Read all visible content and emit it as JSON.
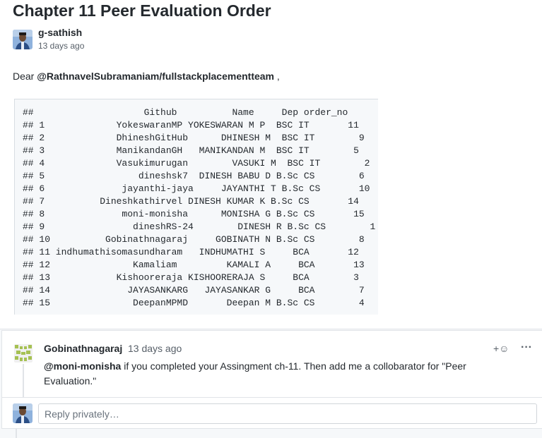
{
  "issue": {
    "title": "Chapter 11 Peer Evaluation Order",
    "author": "g-sathish",
    "time": "13 days ago"
  },
  "body": {
    "greeting_prefix": "Dear ",
    "mention": "@RathnavelSubramaniam/fullstackplacementteam",
    "greeting_suffix": " ,",
    "code_lines": [
      "##                    Github          Name     Dep order_no",
      "## 1             YokeswaranMP YOKESWARAN M P  BSC IT       11",
      "## 2             DhineshGitHub      DHINESH M  BSC IT        9",
      "## 3             ManikandanGH   MANIKANDAN M  BSC IT        5",
      "## 4             Vasukimurugan        VASUKI M  BSC IT        2",
      "## 5                 dineshsk7  DINESH BABU D B.Sc CS        6",
      "## 6              jayanthi-jaya     JAYANTHI T B.Sc CS       10",
      "## 7          Dineshkathirvel DINESH KUMAR K B.Sc CS       14",
      "## 8              moni-monisha      MONISHA G B.Sc CS       15",
      "## 9                dineshRS-24        DINESH R B.Sc CS        1",
      "## 10          Gobinathnagaraj     GOBINATH N B.Sc CS        8",
      "## 11 indhumathisomasundharam   INDHUMATHI S     BCA       12",
      "## 12               Kamaliam         KAMALI A     BCA       13",
      "## 13            Kishooreraja KISHOORERAJA S     BCA        3",
      "## 14              JAYASANKARG   JAYASANKAR G     BCA        7",
      "## 15               DeepanMPMD       Deepan M B.Sc CS        4"
    ]
  },
  "comment": {
    "author": "Gobinathnagaraj",
    "time": "13 days ago",
    "mention": "@moni-monisha",
    "text": " if you completed your Assingment ch-11. Then add me a collobarator for \"Peer Evaluation.\"",
    "emoji_icon": "+☺",
    "more_icon": "···"
  },
  "reply": {
    "placeholder": "Reply privately…"
  },
  "icons": {
    "author_avatar": "user-photo-avatar",
    "commenter_avatar": "identicon-avatar",
    "reaction": "add-reaction-icon",
    "more": "kebab-horizontal-icon"
  }
}
